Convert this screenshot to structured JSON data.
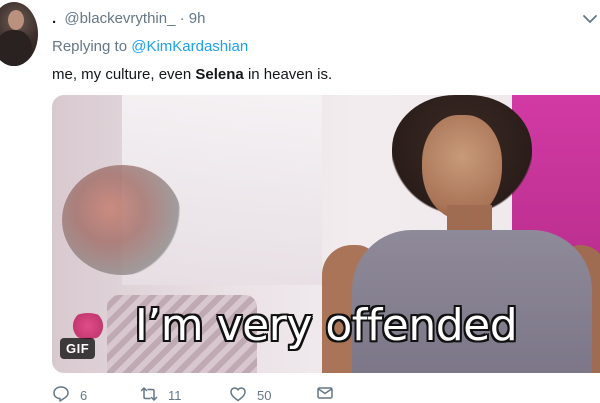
{
  "tweet": {
    "author_handle": "@blackevrythin_",
    "separator": ".",
    "time": "9h",
    "reply_prefix": "Replying to",
    "reply_mention": "@KimKardashian",
    "text_before": "me, my culture, even",
    "text_bold": "Selena",
    "text_after": "in heaven is.",
    "media": {
      "caption": "I’m very offended",
      "badge": "GIF"
    },
    "actions": {
      "replies": "6",
      "retweets": "11",
      "likes": "50"
    },
    "colors": {
      "link": "#1da1f2",
      "muted": "#657786",
      "text": "#14171a"
    },
    "icons": [
      "chevron-down-icon",
      "reply-icon",
      "retweet-icon",
      "like-icon",
      "message-icon"
    ]
  }
}
